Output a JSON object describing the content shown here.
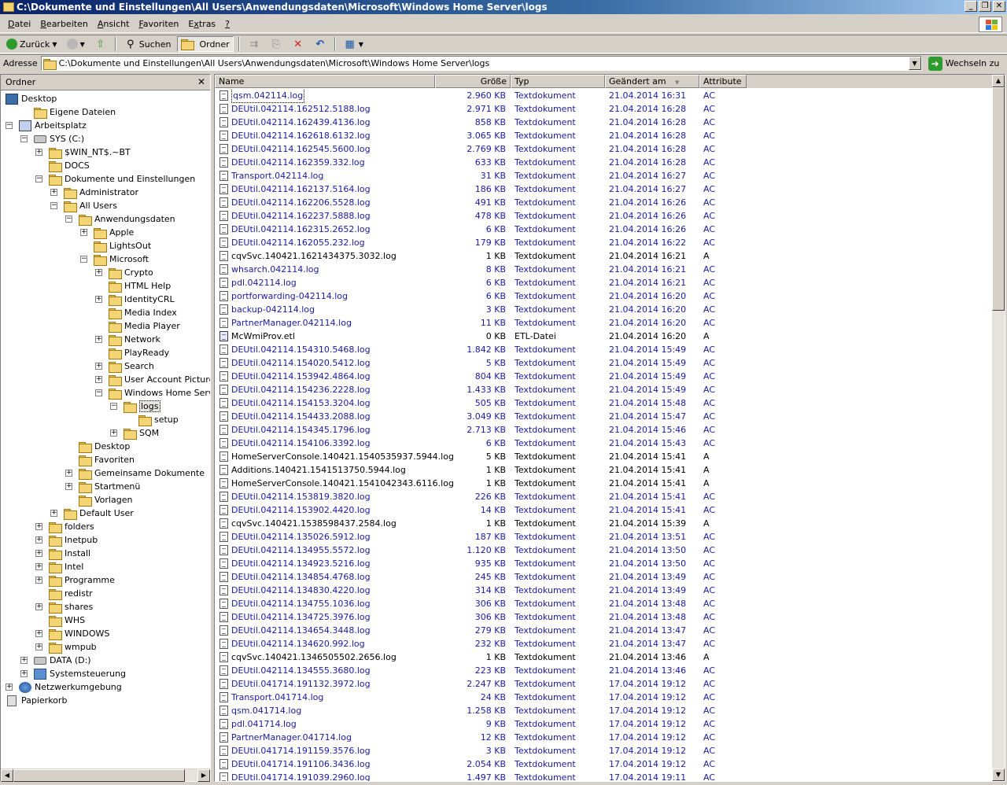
{
  "window": {
    "title": "C:\\Dokumente und Einstellungen\\All Users\\Anwendungsdaten\\Microsoft\\Windows Home Server\\logs",
    "minimize": "_",
    "maximize": "❐",
    "close": "✕"
  },
  "menu": [
    {
      "pre": "",
      "u": "D",
      "post": "atei"
    },
    {
      "pre": "",
      "u": "B",
      "post": "earbeiten"
    },
    {
      "pre": "",
      "u": "A",
      "post": "nsicht"
    },
    {
      "pre": "",
      "u": "F",
      "post": "avoriten"
    },
    {
      "pre": "E",
      "u": "x",
      "post": "tras"
    },
    {
      "pre": "",
      "u": "?",
      "post": ""
    }
  ],
  "toolbar": {
    "back": "Zurück",
    "search": "Suchen",
    "folders": "Ordner"
  },
  "address": {
    "label": "Adresse",
    "value": "C:\\Dokumente und Einstellungen\\All Users\\Anwendungsdaten\\Microsoft\\Windows Home Server\\logs",
    "go": "Wechseln zu"
  },
  "folder_pane": {
    "title": "Ordner",
    "close": "✕"
  },
  "tree": [
    {
      "label": "Desktop",
      "depth": 0,
      "exp": "none",
      "icon": "desk",
      "sel": false
    },
    {
      "label": "Eigene Dateien",
      "depth": 1,
      "exp": "none",
      "icon": "folder",
      "sel": false
    },
    {
      "label": "Arbeitsplatz",
      "depth": 0,
      "exp": "minus",
      "icon": "pc",
      "sel": false
    },
    {
      "label": "SYS (C:)",
      "depth": 1,
      "exp": "minus",
      "icon": "drive",
      "sel": false
    },
    {
      "label": "$WIN_NT$.~BT",
      "depth": 2,
      "exp": "plus",
      "icon": "folder",
      "sel": false
    },
    {
      "label": "DOCS",
      "depth": 2,
      "exp": "none",
      "icon": "folder",
      "sel": false
    },
    {
      "label": "Dokumente und Einstellungen",
      "depth": 2,
      "exp": "minus",
      "icon": "folder",
      "sel": false
    },
    {
      "label": "Administrator",
      "depth": 3,
      "exp": "plus",
      "icon": "folder",
      "sel": false
    },
    {
      "label": "All Users",
      "depth": 3,
      "exp": "minus",
      "icon": "folder",
      "sel": false
    },
    {
      "label": "Anwendungsdaten",
      "depth": 4,
      "exp": "minus",
      "icon": "folder",
      "sel": false
    },
    {
      "label": "Apple",
      "depth": 5,
      "exp": "plus",
      "icon": "folder",
      "sel": false
    },
    {
      "label": "LightsOut",
      "depth": 5,
      "exp": "none",
      "icon": "folder",
      "sel": false
    },
    {
      "label": "Microsoft",
      "depth": 5,
      "exp": "minus",
      "icon": "folder",
      "sel": false
    },
    {
      "label": "Crypto",
      "depth": 6,
      "exp": "plus",
      "icon": "folder",
      "sel": false
    },
    {
      "label": "HTML Help",
      "depth": 6,
      "exp": "none",
      "icon": "folder",
      "sel": false
    },
    {
      "label": "IdentityCRL",
      "depth": 6,
      "exp": "plus",
      "icon": "folder",
      "sel": false
    },
    {
      "label": "Media Index",
      "depth": 6,
      "exp": "none",
      "icon": "folder",
      "sel": false
    },
    {
      "label": "Media Player",
      "depth": 6,
      "exp": "none",
      "icon": "folder",
      "sel": false
    },
    {
      "label": "Network",
      "depth": 6,
      "exp": "plus",
      "icon": "folder",
      "sel": false
    },
    {
      "label": "PlayReady",
      "depth": 6,
      "exp": "none",
      "icon": "folder",
      "sel": false
    },
    {
      "label": "Search",
      "depth": 6,
      "exp": "plus",
      "icon": "folder",
      "sel": false
    },
    {
      "label": "User Account Pictures",
      "depth": 6,
      "exp": "plus",
      "icon": "folder",
      "sel": false
    },
    {
      "label": "Windows Home Server",
      "depth": 6,
      "exp": "minus",
      "icon": "folder",
      "sel": false
    },
    {
      "label": "logs",
      "depth": 7,
      "exp": "minus",
      "icon": "folder",
      "sel": true
    },
    {
      "label": "setup",
      "depth": 8,
      "exp": "none",
      "icon": "folder",
      "sel": false
    },
    {
      "label": "SQM",
      "depth": 7,
      "exp": "plus",
      "icon": "folder",
      "sel": false
    },
    {
      "label": "Desktop",
      "depth": 4,
      "exp": "none",
      "icon": "folder",
      "sel": false
    },
    {
      "label": "Favoriten",
      "depth": 4,
      "exp": "none",
      "icon": "folder",
      "sel": false
    },
    {
      "label": "Gemeinsame Dokumente",
      "depth": 4,
      "exp": "plus",
      "icon": "folder",
      "sel": false
    },
    {
      "label": "Startmenü",
      "depth": 4,
      "exp": "plus",
      "icon": "folder",
      "sel": false
    },
    {
      "label": "Vorlagen",
      "depth": 4,
      "exp": "none",
      "icon": "folder",
      "sel": false
    },
    {
      "label": "Default User",
      "depth": 3,
      "exp": "plus",
      "icon": "folder",
      "sel": false
    },
    {
      "label": "folders",
      "depth": 2,
      "exp": "plus",
      "icon": "folder",
      "sel": false
    },
    {
      "label": "Inetpub",
      "depth": 2,
      "exp": "plus",
      "icon": "folder",
      "sel": false
    },
    {
      "label": "Install",
      "depth": 2,
      "exp": "plus",
      "icon": "folder",
      "sel": false
    },
    {
      "label": "Intel",
      "depth": 2,
      "exp": "plus",
      "icon": "folder",
      "sel": false
    },
    {
      "label": "Programme",
      "depth": 2,
      "exp": "plus",
      "icon": "folder",
      "sel": false
    },
    {
      "label": "redistr",
      "depth": 2,
      "exp": "none",
      "icon": "folder",
      "sel": false
    },
    {
      "label": "shares",
      "depth": 2,
      "exp": "plus",
      "icon": "folder",
      "sel": false
    },
    {
      "label": "WHS",
      "depth": 2,
      "exp": "none",
      "icon": "folder",
      "sel": false
    },
    {
      "label": "WINDOWS",
      "depth": 2,
      "exp": "plus",
      "icon": "folder",
      "sel": false
    },
    {
      "label": "wmpub",
      "depth": 2,
      "exp": "plus",
      "icon": "folder",
      "sel": false
    },
    {
      "label": "DATA (D:)",
      "depth": 1,
      "exp": "plus",
      "icon": "drive",
      "sel": false
    },
    {
      "label": "Systemsteuerung",
      "depth": 1,
      "exp": "plus",
      "icon": "cp",
      "sel": false
    },
    {
      "label": "Netzwerkumgebung",
      "depth": 0,
      "exp": "plus",
      "icon": "net",
      "sel": false
    },
    {
      "label": "Papierkorb",
      "depth": 0,
      "exp": "none",
      "icon": "trash",
      "sel": false
    }
  ],
  "columns": {
    "name": "Name",
    "size": "Größe",
    "type": "Typ",
    "modified": "Geändert am",
    "attributes": "Attribute",
    "sort_indicator": "▼"
  },
  "colors": {
    "compressed_text": "#1a1aa0",
    "normal_text": "#000000"
  },
  "files": [
    {
      "name": "qsm.042114.log",
      "size": "2.960 KB",
      "type": "Textdokument",
      "date": "21.04.2014 16:31",
      "attr": "AC"
    },
    {
      "name": "DEUtil.042114.162512.5188.log",
      "size": "2.971 KB",
      "type": "Textdokument",
      "date": "21.04.2014 16:28",
      "attr": "AC"
    },
    {
      "name": "DEUtil.042114.162439.4136.log",
      "size": "858 KB",
      "type": "Textdokument",
      "date": "21.04.2014 16:28",
      "attr": "AC"
    },
    {
      "name": "DEUtil.042114.162618.6132.log",
      "size": "3.065 KB",
      "type": "Textdokument",
      "date": "21.04.2014 16:28",
      "attr": "AC"
    },
    {
      "name": "DEUtil.042114.162545.5600.log",
      "size": "2.769 KB",
      "type": "Textdokument",
      "date": "21.04.2014 16:28",
      "attr": "AC"
    },
    {
      "name": "DEUtil.042114.162359.332.log",
      "size": "633 KB",
      "type": "Textdokument",
      "date": "21.04.2014 16:28",
      "attr": "AC"
    },
    {
      "name": "Transport.042114.log",
      "size": "31 KB",
      "type": "Textdokument",
      "date": "21.04.2014 16:27",
      "attr": "AC"
    },
    {
      "name": "DEUtil.042114.162137.5164.log",
      "size": "186 KB",
      "type": "Textdokument",
      "date": "21.04.2014 16:27",
      "attr": "AC"
    },
    {
      "name": "DEUtil.042114.162206.5528.log",
      "size": "491 KB",
      "type": "Textdokument",
      "date": "21.04.2014 16:26",
      "attr": "AC"
    },
    {
      "name": "DEUtil.042114.162237.5888.log",
      "size": "478 KB",
      "type": "Textdokument",
      "date": "21.04.2014 16:26",
      "attr": "AC"
    },
    {
      "name": "DEUtil.042114.162315.2652.log",
      "size": "6 KB",
      "type": "Textdokument",
      "date": "21.04.2014 16:26",
      "attr": "AC"
    },
    {
      "name": "DEUtil.042114.162055.232.log",
      "size": "179 KB",
      "type": "Textdokument",
      "date": "21.04.2014 16:22",
      "attr": "AC"
    },
    {
      "name": "cqvSvc.140421.1621434375.3032.log",
      "size": "1 KB",
      "type": "Textdokument",
      "date": "21.04.2014 16:21",
      "attr": "A"
    },
    {
      "name": "whsarch.042114.log",
      "size": "8 KB",
      "type": "Textdokument",
      "date": "21.04.2014 16:21",
      "attr": "AC"
    },
    {
      "name": "pdl.042114.log",
      "size": "6 KB",
      "type": "Textdokument",
      "date": "21.04.2014 16:21",
      "attr": "AC"
    },
    {
      "name": "portforwarding-042114.log",
      "size": "6 KB",
      "type": "Textdokument",
      "date": "21.04.2014 16:20",
      "attr": "AC"
    },
    {
      "name": "backup-042114.log",
      "size": "3 KB",
      "type": "Textdokument",
      "date": "21.04.2014 16:20",
      "attr": "AC"
    },
    {
      "name": "PartnerManager.042114.log",
      "size": "11 KB",
      "type": "Textdokument",
      "date": "21.04.2014 16:20",
      "attr": "AC"
    },
    {
      "name": "McWmiProv.etl",
      "size": "0 KB",
      "type": "ETL-Datei",
      "date": "21.04.2014 16:20",
      "attr": "A",
      "etl": true
    },
    {
      "name": "DEUtil.042114.154310.5468.log",
      "size": "1.842 KB",
      "type": "Textdokument",
      "date": "21.04.2014 15:49",
      "attr": "AC"
    },
    {
      "name": "DEUtil.042114.154020.5412.log",
      "size": "5 KB",
      "type": "Textdokument",
      "date": "21.04.2014 15:49",
      "attr": "AC"
    },
    {
      "name": "DEUtil.042114.153942.4864.log",
      "size": "804 KB",
      "type": "Textdokument",
      "date": "21.04.2014 15:49",
      "attr": "AC"
    },
    {
      "name": "DEUtil.042114.154236.2228.log",
      "size": "1.433 KB",
      "type": "Textdokument",
      "date": "21.04.2014 15:49",
      "attr": "AC"
    },
    {
      "name": "DEUtil.042114.154153.3204.log",
      "size": "505 KB",
      "type": "Textdokument",
      "date": "21.04.2014 15:48",
      "attr": "AC"
    },
    {
      "name": "DEUtil.042114.154433.2088.log",
      "size": "3.049 KB",
      "type": "Textdokument",
      "date": "21.04.2014 15:47",
      "attr": "AC"
    },
    {
      "name": "DEUtil.042114.154345.1796.log",
      "size": "2.713 KB",
      "type": "Textdokument",
      "date": "21.04.2014 15:46",
      "attr": "AC"
    },
    {
      "name": "DEUtil.042114.154106.3392.log",
      "size": "6 KB",
      "type": "Textdokument",
      "date": "21.04.2014 15:43",
      "attr": "AC"
    },
    {
      "name": "HomeServerConsole.140421.1540535937.5944.log",
      "size": "5 KB",
      "type": "Textdokument",
      "date": "21.04.2014 15:41",
      "attr": "A"
    },
    {
      "name": "Additions.140421.1541513750.5944.log",
      "size": "1 KB",
      "type": "Textdokument",
      "date": "21.04.2014 15:41",
      "attr": "A"
    },
    {
      "name": "HomeServerConsole.140421.1541042343.6116.log",
      "size": "1 KB",
      "type": "Textdokument",
      "date": "21.04.2014 15:41",
      "attr": "A"
    },
    {
      "name": "DEUtil.042114.153819.3820.log",
      "size": "226 KB",
      "type": "Textdokument",
      "date": "21.04.2014 15:41",
      "attr": "AC"
    },
    {
      "name": "DEUtil.042114.153902.4420.log",
      "size": "14 KB",
      "type": "Textdokument",
      "date": "21.04.2014 15:41",
      "attr": "AC"
    },
    {
      "name": "cqvSvc.140421.1538598437.2584.log",
      "size": "1 KB",
      "type": "Textdokument",
      "date": "21.04.2014 15:39",
      "attr": "A"
    },
    {
      "name": "DEUtil.042114.135026.5912.log",
      "size": "187 KB",
      "type": "Textdokument",
      "date": "21.04.2014 13:51",
      "attr": "AC"
    },
    {
      "name": "DEUtil.042114.134955.5572.log",
      "size": "1.120 KB",
      "type": "Textdokument",
      "date": "21.04.2014 13:50",
      "attr": "AC"
    },
    {
      "name": "DEUtil.042114.134923.5216.log",
      "size": "935 KB",
      "type": "Textdokument",
      "date": "21.04.2014 13:50",
      "attr": "AC"
    },
    {
      "name": "DEUtil.042114.134854.4768.log",
      "size": "245 KB",
      "type": "Textdokument",
      "date": "21.04.2014 13:49",
      "attr": "AC"
    },
    {
      "name": "DEUtil.042114.134830.4220.log",
      "size": "314 KB",
      "type": "Textdokument",
      "date": "21.04.2014 13:49",
      "attr": "AC"
    },
    {
      "name": "DEUtil.042114.134755.1036.log",
      "size": "306 KB",
      "type": "Textdokument",
      "date": "21.04.2014 13:48",
      "attr": "AC"
    },
    {
      "name": "DEUtil.042114.134725.3976.log",
      "size": "306 KB",
      "type": "Textdokument",
      "date": "21.04.2014 13:48",
      "attr": "AC"
    },
    {
      "name": "DEUtil.042114.134654.3448.log",
      "size": "279 KB",
      "type": "Textdokument",
      "date": "21.04.2014 13:47",
      "attr": "AC"
    },
    {
      "name": "DEUtil.042114.134620.992.log",
      "size": "232 KB",
      "type": "Textdokument",
      "date": "21.04.2014 13:47",
      "attr": "AC"
    },
    {
      "name": "cqvSvc.140421.1346505502.2656.log",
      "size": "1 KB",
      "type": "Textdokument",
      "date": "21.04.2014 13:46",
      "attr": "A"
    },
    {
      "name": "DEUtil.042114.134555.3680.log",
      "size": "223 KB",
      "type": "Textdokument",
      "date": "21.04.2014 13:46",
      "attr": "AC"
    },
    {
      "name": "DEUtil.041714.191132.3972.log",
      "size": "2.247 KB",
      "type": "Textdokument",
      "date": "17.04.2014 19:12",
      "attr": "AC"
    },
    {
      "name": "Transport.041714.log",
      "size": "24 KB",
      "type": "Textdokument",
      "date": "17.04.2014 19:12",
      "attr": "AC"
    },
    {
      "name": "qsm.041714.log",
      "size": "1.258 KB",
      "type": "Textdokument",
      "date": "17.04.2014 19:12",
      "attr": "AC"
    },
    {
      "name": "pdl.041714.log",
      "size": "9 KB",
      "type": "Textdokument",
      "date": "17.04.2014 19:12",
      "attr": "AC"
    },
    {
      "name": "PartnerManager.041714.log",
      "size": "12 KB",
      "type": "Textdokument",
      "date": "17.04.2014 19:12",
      "attr": "AC"
    },
    {
      "name": "DEUtil.041714.191159.3576.log",
      "size": "3 KB",
      "type": "Textdokument",
      "date": "17.04.2014 19:12",
      "attr": "AC"
    },
    {
      "name": "DEUtil.041714.191106.3436.log",
      "size": "2.054 KB",
      "type": "Textdokument",
      "date": "17.04.2014 19:12",
      "attr": "AC"
    },
    {
      "name": "DEUtil.041714.191039.2960.log",
      "size": "1.497 KB",
      "type": "Textdokument",
      "date": "17.04.2014 19:11",
      "attr": "AC"
    }
  ]
}
